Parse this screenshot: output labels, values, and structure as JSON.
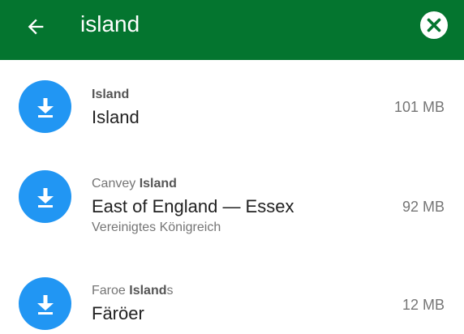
{
  "toolbar": {
    "back_icon": "arrow-left-icon",
    "search_value": "island",
    "clear_icon": "close-circle-icon",
    "color": "#04752f"
  },
  "results": [
    {
      "subtitle_prefix": "",
      "subtitle_match": "Island",
      "subtitle_suffix": "",
      "title": "Island",
      "region": "",
      "size": "101 MB",
      "icon": "download-icon"
    },
    {
      "subtitle_prefix": "Canvey ",
      "subtitle_match": "Island",
      "subtitle_suffix": "",
      "title": "East of England — Essex",
      "region": "Vereinigtes Königreich",
      "size": "92 MB",
      "icon": "download-icon"
    },
    {
      "subtitle_prefix": "Faroe ",
      "subtitle_match": "Island",
      "subtitle_suffix": "s",
      "title": "Färöer",
      "region": "",
      "size": "12 MB",
      "icon": "download-icon"
    }
  ],
  "colors": {
    "accent": "#2196f3",
    "toolbar": "#04752f"
  }
}
